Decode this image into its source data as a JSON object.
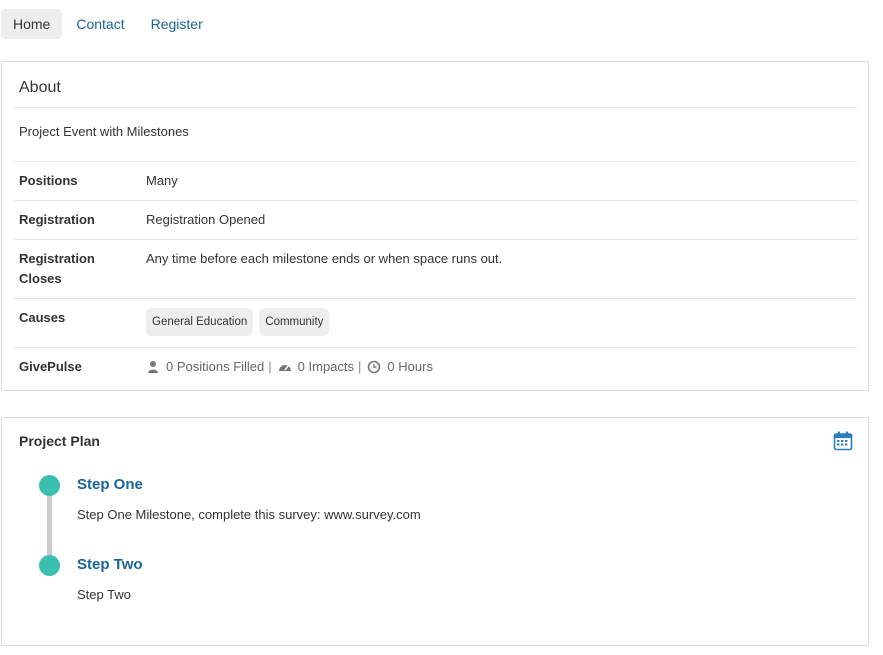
{
  "nav": {
    "items": [
      {
        "label": "Home",
        "active": true
      },
      {
        "label": "Contact",
        "active": false
      },
      {
        "label": "Register",
        "active": false
      }
    ]
  },
  "about": {
    "title": "About",
    "description": "Project Event with Milestones",
    "rows": {
      "positions": {
        "label": "Positions",
        "value": "Many"
      },
      "registration": {
        "label": "Registration",
        "value": "Registration Opened"
      },
      "registration_closes": {
        "label": "Registration Closes",
        "value": "Any time before each milestone ends or when space runs out."
      },
      "causes": {
        "label": "Causes",
        "badges": [
          "General Education",
          "Community"
        ]
      },
      "givepulse": {
        "label": "GivePulse",
        "positions_filled": "0 Positions Filled",
        "impacts": "0 Impacts",
        "hours": "0 Hours",
        "separator": "|"
      }
    }
  },
  "plan": {
    "title": "Project Plan",
    "steps": [
      {
        "title": "Step One",
        "description": "Step One Milestone, complete this survey: www.survey.com"
      },
      {
        "title": "Step Two",
        "description": "Step Two"
      }
    ]
  },
  "colors": {
    "link": "#1a6496",
    "milestone_dot": "#3bbfb0",
    "timeline": "#cccccc",
    "calendar_icon": "#2a7fc1"
  },
  "icons": [
    "user-icon",
    "gauge-icon",
    "clock-icon",
    "calendar-icon"
  ]
}
